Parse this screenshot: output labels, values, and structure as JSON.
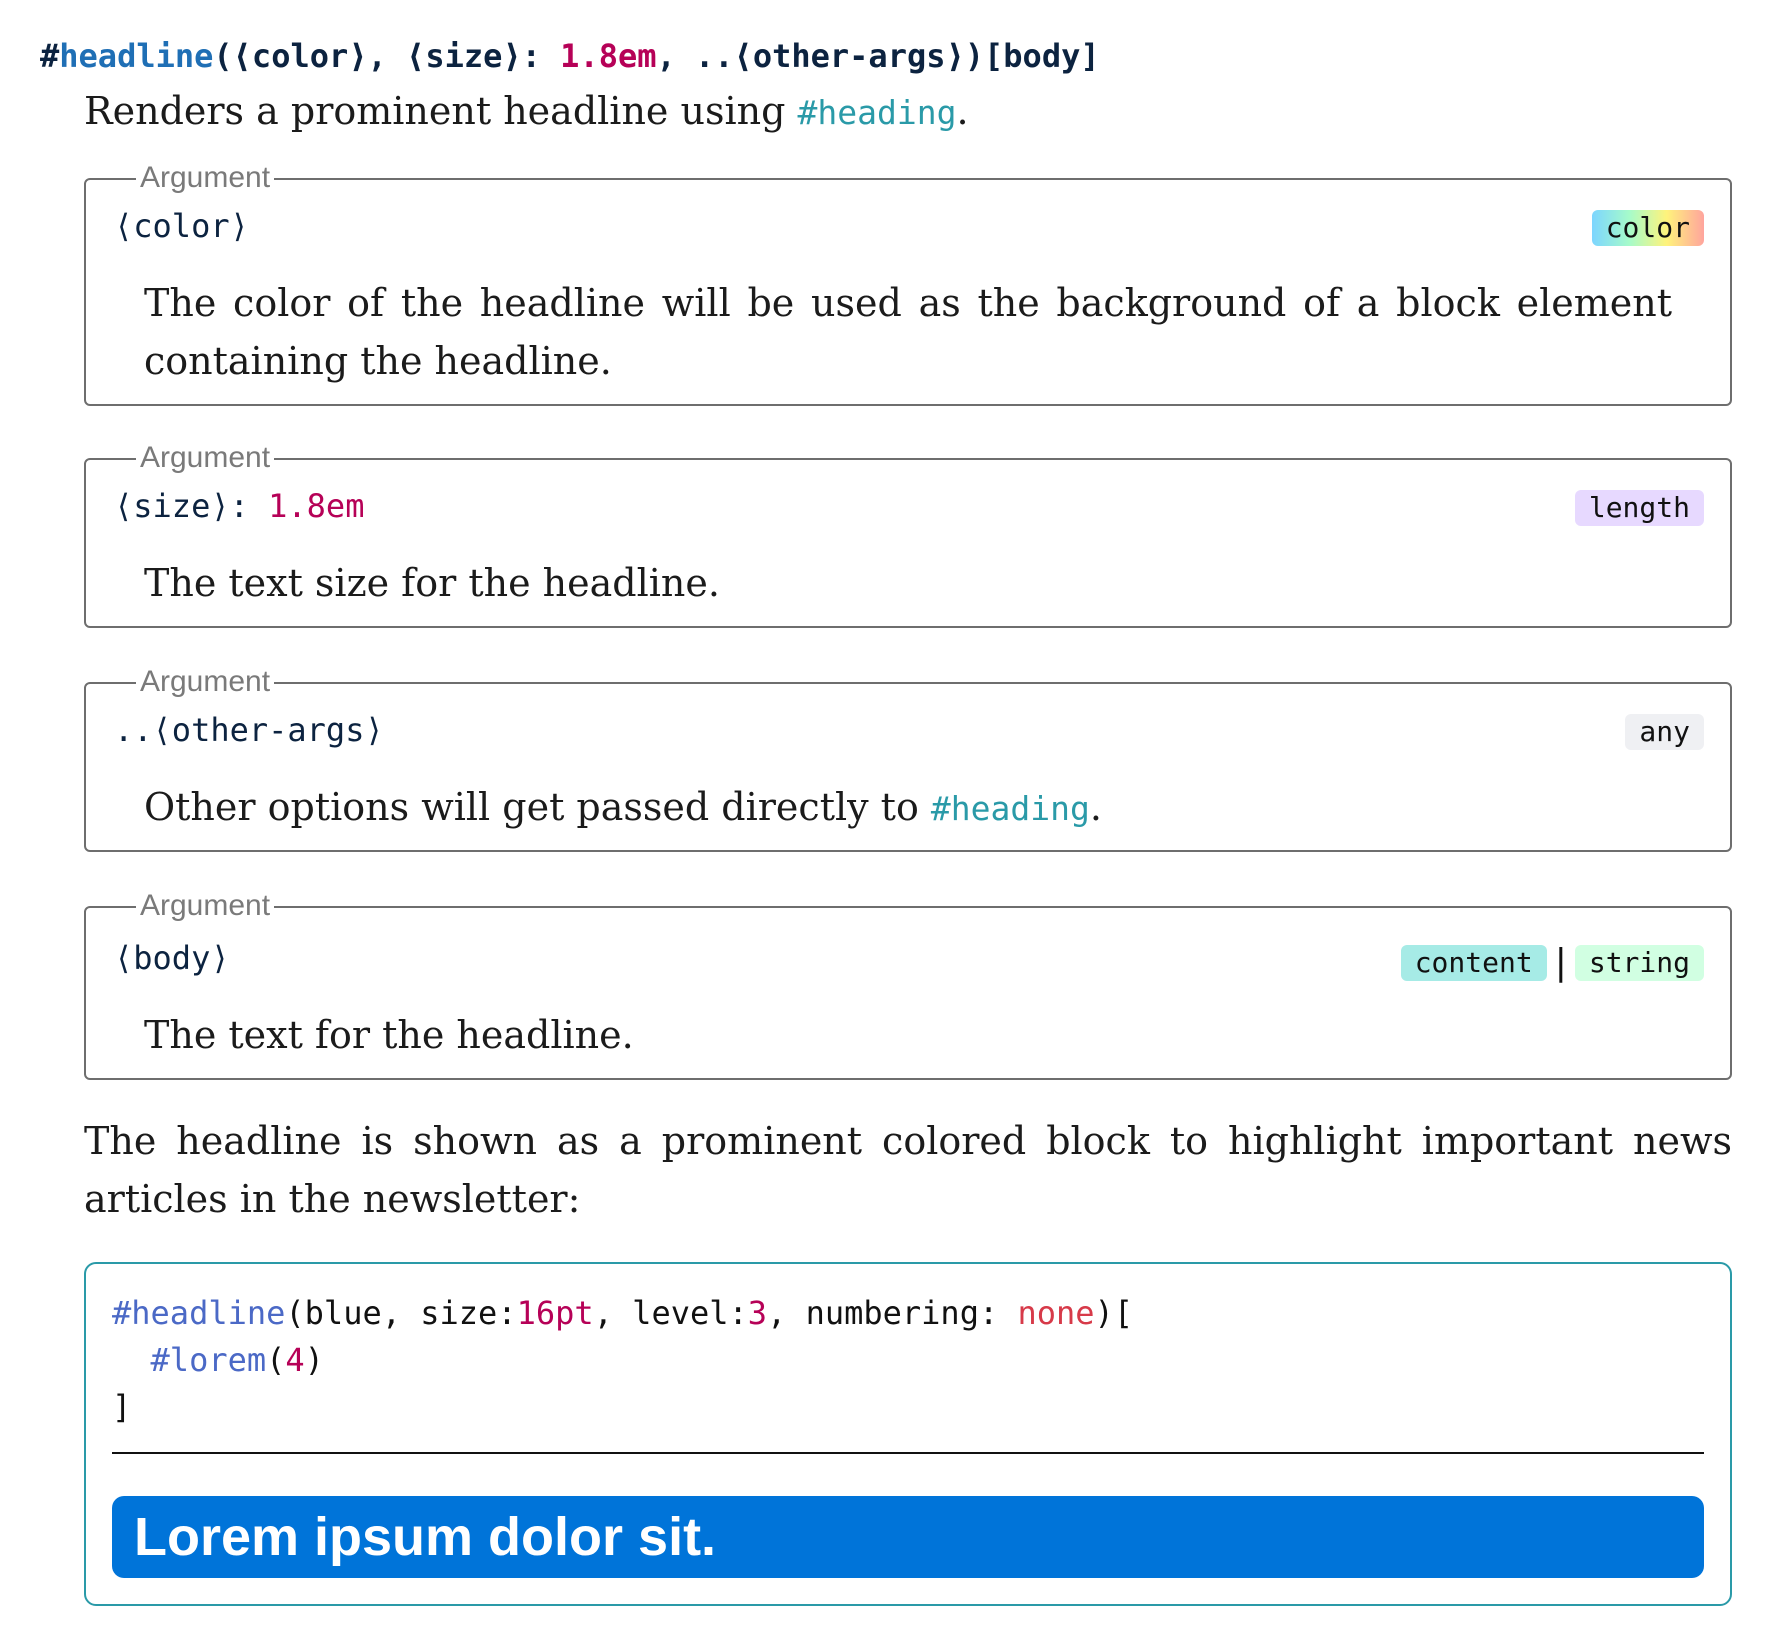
{
  "signature": {
    "hash": "#",
    "name": "headline",
    "open": "(",
    "p1": "⟨color⟩",
    "sep1": ", ",
    "p2": "⟨size⟩",
    "colon": ": ",
    "p2_default": "1.8em",
    "sep2": ", ",
    "p3": "..⟨other-args⟩",
    "close": ")",
    "body": "[body]"
  },
  "description": {
    "prefix": "Renders a prominent headline using ",
    "hash": "#",
    "link": "heading",
    "suffix": "."
  },
  "arguments": [
    {
      "legend": "Argument",
      "name": "⟨color⟩",
      "default_sep": "",
      "default": "",
      "types": [
        "color"
      ],
      "text": "The color of the headline will be used as the background of a block element containing the headline."
    },
    {
      "legend": "Argument",
      "name": "⟨size⟩",
      "default_sep": ": ",
      "default": "1.8em",
      "types": [
        "length"
      ],
      "text": "The text size for the headline."
    },
    {
      "legend": "Argument",
      "name": "..⟨other-args⟩",
      "default_sep": "",
      "default": "",
      "types": [
        "any"
      ],
      "text_prefix": "Other options will get passed directly to ",
      "text_hash": "#",
      "text_link": "heading",
      "text_suffix": "."
    },
    {
      "legend": "Argument",
      "name": "⟨body⟩",
      "default_sep": "",
      "default": "",
      "types": [
        "content",
        "string"
      ],
      "type_separator": "|",
      "text": "The text for the headline."
    }
  ],
  "type_colors": {
    "color": "linear-gradient(90deg,#7cd5ff,#a6fbca,#fff37c,#ffa49d)",
    "length": "#e7d9ff",
    "any": "#eff0f3",
    "content": "#a6ebe6",
    "string": "#d1ffe2"
  },
  "paragraph": "The headline is shown as a prominent colored block to highlight important news articles in the newsletter:",
  "example": {
    "line1": {
      "fn": "#headline",
      "a": "(blue, size:",
      "size": "16pt",
      "b": ", level:",
      "level": "3",
      "c": ", numbering: ",
      "numbering": "none",
      "d": ")["
    },
    "line2": {
      "indent": "  ",
      "fn": "#lorem",
      "a": "(",
      "n": "4",
      "b": ")"
    },
    "line3": "]",
    "rendered_headline": "Lorem ipsum dolor sit.",
    "rendered_color": "#0074d9"
  }
}
